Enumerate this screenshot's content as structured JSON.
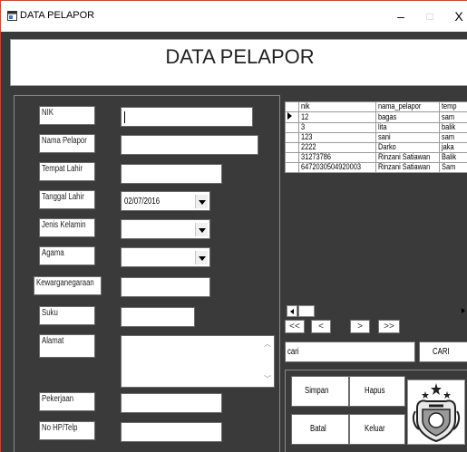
{
  "window": {
    "title": "DATA PELAPOR",
    "min_glyph": "–",
    "max_glyph": "□",
    "close_glyph": "X"
  },
  "header": {
    "title": "DATA PELAPOR"
  },
  "form": {
    "nik_label": "NIK",
    "nik_value": "",
    "nama_label": "Nama Pelapor",
    "nama_value": "",
    "tempat_label": "Tempat Lahir",
    "tempat_value": "",
    "tanggal_label": "Tanggal Lahir",
    "tanggal_value": "02/07/2016",
    "jk_label": "Jenis Kelamin",
    "jk_value": "",
    "agama_label": "Agama",
    "agama_value": "",
    "kw_label": "Kewarganegaraan",
    "kw_value": "",
    "suku_label": "Suku",
    "suku_value": "",
    "alamat_label": "Alamat",
    "alamat_value": "",
    "pekerjaan_label": "Pekerjaan",
    "pekerjaan_value": "",
    "hp_label": "No HP/Telp",
    "hp_value": ""
  },
  "grid": {
    "columns": [
      "nik",
      "nama_pelapor",
      "temp"
    ],
    "rows": [
      [
        "12",
        "bagas",
        "sam"
      ],
      [
        "3",
        "lita",
        "balik"
      ],
      [
        "123",
        "sani",
        "sam"
      ],
      [
        "2222",
        "Darko",
        "jaka"
      ],
      [
        "31273786",
        "Rinzani Satiawan",
        "Balik"
      ],
      [
        "6472030504920003",
        "Rinzani Satiawan",
        "Sam"
      ]
    ]
  },
  "nav": {
    "first": "<<",
    "prev": "<",
    "next": ">",
    "last": ">>"
  },
  "search": {
    "value": "cari",
    "button": "CARI"
  },
  "actions": {
    "simpan": "Simpan",
    "hapus": "Hapus",
    "batal": "Batal",
    "keluar": "Keluar"
  },
  "colors": {
    "panel_bg": "#3a3a3a",
    "window_border": "#c8463c"
  }
}
